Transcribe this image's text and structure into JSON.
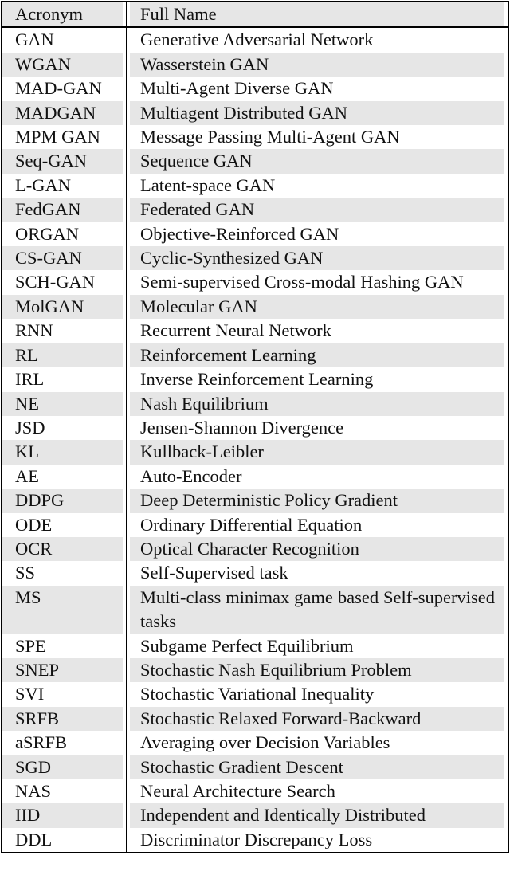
{
  "table": {
    "headers": {
      "acronym": "Acronym",
      "full_name": "Full Name"
    },
    "rows": [
      {
        "acronym": "GAN",
        "full_name": "Generative Adversarial Network"
      },
      {
        "acronym": "WGAN",
        "full_name": "Wasserstein GAN"
      },
      {
        "acronym": "MAD-GAN",
        "full_name": "Multi-Agent Diverse GAN"
      },
      {
        "acronym": "MADGAN",
        "full_name": "Multiagent Distributed GAN"
      },
      {
        "acronym": "MPM GAN",
        "full_name": "Message Passing Multi-Agent GAN"
      },
      {
        "acronym": "Seq-GAN",
        "full_name": "Sequence GAN"
      },
      {
        "acronym": "L-GAN",
        "full_name": "Latent-space GAN"
      },
      {
        "acronym": "FedGAN",
        "full_name": "Federated GAN"
      },
      {
        "acronym": "ORGAN",
        "full_name": "Objective-Reinforced GAN"
      },
      {
        "acronym": "CS-GAN",
        "full_name": "Cyclic-Synthesized GAN"
      },
      {
        "acronym": "SCH-GAN",
        "full_name": "Semi-supervised Cross-modal Hashing GAN"
      },
      {
        "acronym": "MolGAN",
        "full_name": "Molecular GAN"
      },
      {
        "acronym": "RNN",
        "full_name": "Recurrent Neural Network"
      },
      {
        "acronym": "RL",
        "full_name": "Reinforcement Learning"
      },
      {
        "acronym": "IRL",
        "full_name": "Inverse Reinforcement Learning"
      },
      {
        "acronym": "NE",
        "full_name": "Nash Equilibrium"
      },
      {
        "acronym": "JSD",
        "full_name": "Jensen-Shannon Divergence"
      },
      {
        "acronym": "KL",
        "full_name": "Kullback-Leibler"
      },
      {
        "acronym": "AE",
        "full_name": "Auto-Encoder"
      },
      {
        "acronym": "DDPG",
        "full_name": "Deep Deterministic Policy Gradient"
      },
      {
        "acronym": "ODE",
        "full_name": "Ordinary Differential Equation"
      },
      {
        "acronym": "OCR",
        "full_name": "Optical Character Recognition"
      },
      {
        "acronym": "SS",
        "full_name": "Self-Supervised task"
      },
      {
        "acronym": "MS",
        "full_name": "Multi-class minimax game based Self-supervised tasks"
      },
      {
        "acronym": "SPE",
        "full_name": "Subgame Perfect Equilibrium"
      },
      {
        "acronym": "SNEP",
        "full_name": "Stochastic Nash Equilibrium Problem"
      },
      {
        "acronym": "SVI",
        "full_name": "Stochastic Variational Inequality"
      },
      {
        "acronym": "SRFB",
        "full_name": "Stochastic Relaxed Forward-Backward"
      },
      {
        "acronym": "aSRFB",
        "full_name": "Averaging over Decision Variables"
      },
      {
        "acronym": "SGD",
        "full_name": "Stochastic Gradient Descent"
      },
      {
        "acronym": "NAS",
        "full_name": "Neural Architecture Search"
      },
      {
        "acronym": "IID",
        "full_name": "Independent and Identically Distributed"
      },
      {
        "acronym": "DDL",
        "full_name": "Discriminator Discrepancy Loss"
      }
    ]
  },
  "colors": {
    "row_shade": "#e6e6e6",
    "rule": "#000000",
    "text": "#111111"
  }
}
